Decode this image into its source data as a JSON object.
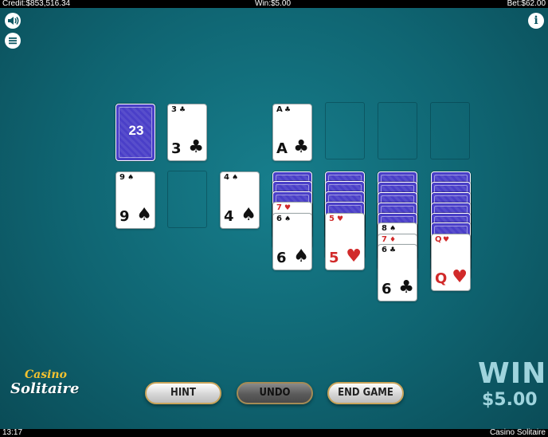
{
  "topbar": {
    "credit": "Credit:$853,516.34",
    "win": "Win:$5.00",
    "bet": "Bet:$62.00"
  },
  "bottombar": {
    "time": "13:17",
    "game_name": "Casino Solitaire"
  },
  "controls": {
    "sound_icon": "speaker-icon",
    "menu_icon": "hamburger-menu-icon",
    "info_label": "i"
  },
  "stock": {
    "remaining": "23"
  },
  "waste": {
    "rank": "3",
    "suit": "♣",
    "color": "black"
  },
  "foundations": [
    {
      "rank": "A",
      "suit": "♣",
      "color": "black"
    }
  ],
  "reserve": [
    {
      "rank": "9",
      "suit": "♠",
      "color": "black"
    },
    {
      "rank": "4",
      "suit": "♠",
      "color": "black"
    }
  ],
  "tableau": [
    {
      "peeks": [
        {
          "rank": "7",
          "suit": "♥",
          "color": "red"
        }
      ],
      "top": {
        "rank": "6",
        "suit": "♠",
        "color": "black"
      }
    },
    {
      "peeks": [],
      "top": {
        "rank": "5",
        "suit": "♥",
        "color": "red"
      }
    },
    {
      "peeks": [
        {
          "rank": "8",
          "suit": "♠",
          "color": "black"
        },
        {
          "rank": "7",
          "suit": "♦",
          "color": "red"
        }
      ],
      "top": {
        "rank": "6",
        "suit": "♣",
        "color": "black"
      }
    },
    {
      "peeks": [],
      "top": {
        "rank": "Q",
        "suit": "♥",
        "color": "red"
      }
    }
  ],
  "logo": {
    "line1": "Casino",
    "line2": "Solitaire"
  },
  "buttons": {
    "hint": "HINT",
    "undo": "UNDO",
    "end_game": "END GAME"
  },
  "win_display": {
    "label": "WIN",
    "amount": "$5.00"
  },
  "colors": {
    "felt": "#0f6471",
    "card_back": "#4a3fc8",
    "red_suit": "#d12a2a",
    "logo_gold": "#f2c230",
    "win_text": "#9fd4dd"
  }
}
